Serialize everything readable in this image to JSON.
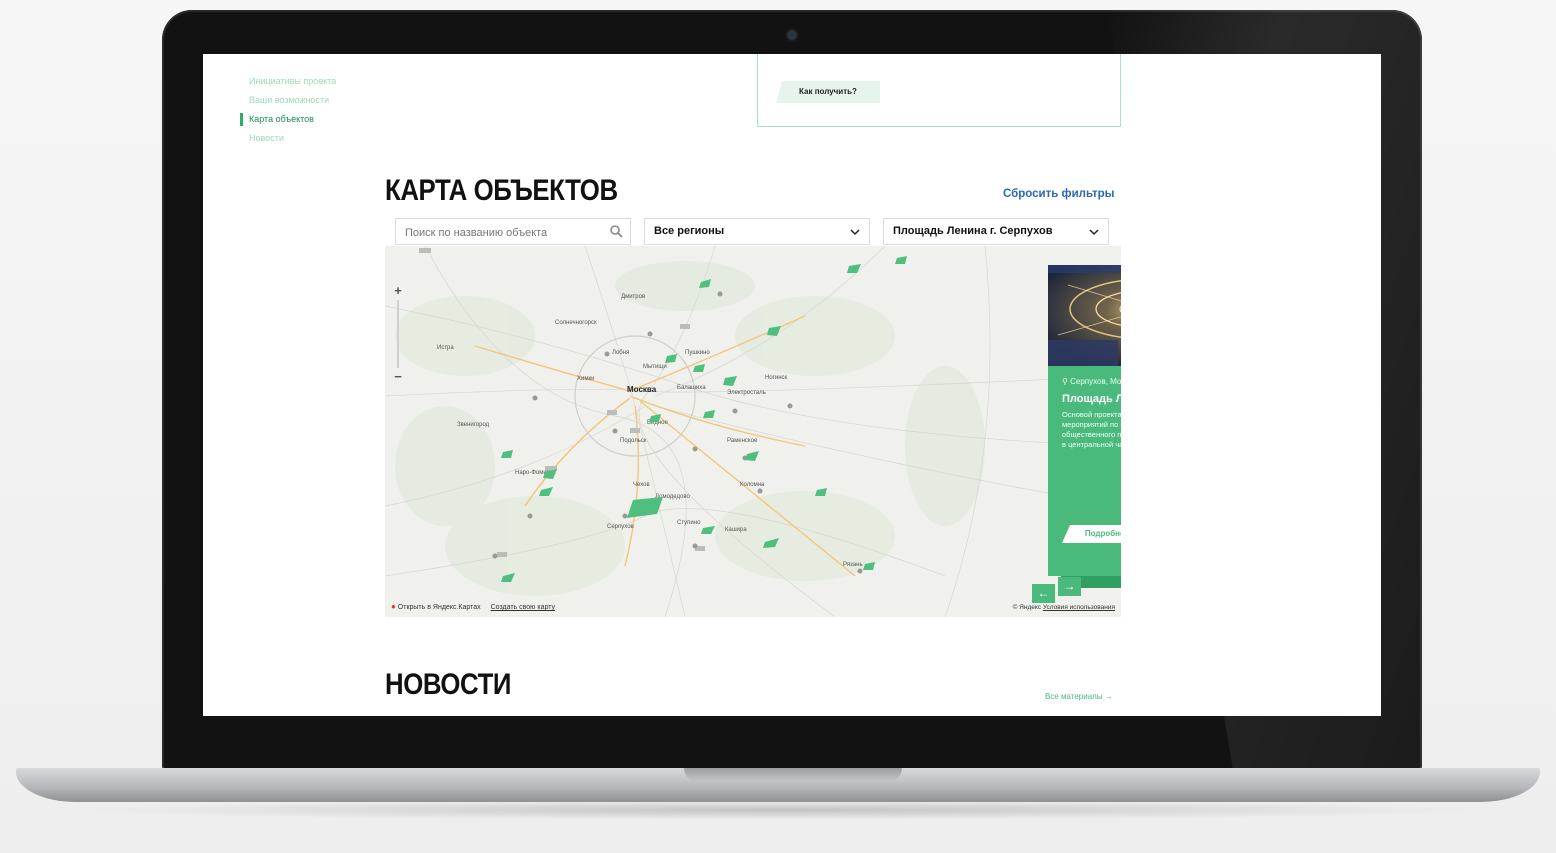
{
  "side_nav": {
    "items": [
      {
        "label": "Инициативы проекта",
        "active": false
      },
      {
        "label": "Ваши возможности",
        "active": false
      },
      {
        "label": "Карта объектов",
        "active": true
      },
      {
        "label": "Новости",
        "active": false
      }
    ]
  },
  "info_box": {
    "how_get_label": "Как получить?"
  },
  "map_section": {
    "title": "КАРТА ОБЪЕКТОВ",
    "reset_label": "Сбросить фильтры",
    "search": {
      "placeholder": "Поиск по названию объекта",
      "value": ""
    },
    "region_select": {
      "value": "Все регионы"
    },
    "object_select": {
      "value": "Площадь Ленина г. Серпухов"
    },
    "map": {
      "zoom_in": "+",
      "zoom_out": "−",
      "open_yandex": "Открыть в Яндекс.Картах",
      "create_map": "Создать свою карту",
      "copyright": "© Яндекс",
      "terms": "Условия использования",
      "labels": [
        "Москва",
        "Серпухов",
        "Балашиха",
        "Подольск",
        "Электросталь",
        "Видное",
        "Раменское",
        "Домодедово",
        "Дмитров",
        "Солнечногорск",
        "Коломна",
        "Кашира",
        "Ступино",
        "Чехов",
        "Наро-Фоминск",
        "Звенигород",
        "Лобня",
        "Мытищи",
        "Химки",
        "Истра",
        "Пушкино",
        "Ногинск",
        "Рязань"
      ],
      "pins_count": 22
    },
    "card": {
      "location": "Серпухов, Московская область",
      "title": "Площадь Ленина г. Серпухов",
      "description": "Основой проекта являлось выполнение мероприятий по благоустройству общественного пространства, расположенного в центральной части города.",
      "button": "Подробнее →",
      "prev": "←",
      "next": "→"
    }
  },
  "news_section": {
    "title": "НОВОСТИ",
    "all_label": "Все материалы →"
  },
  "colors": {
    "accent": "#49ba7c",
    "accent_dark": "#2fa060",
    "link": "#2a68b5"
  }
}
